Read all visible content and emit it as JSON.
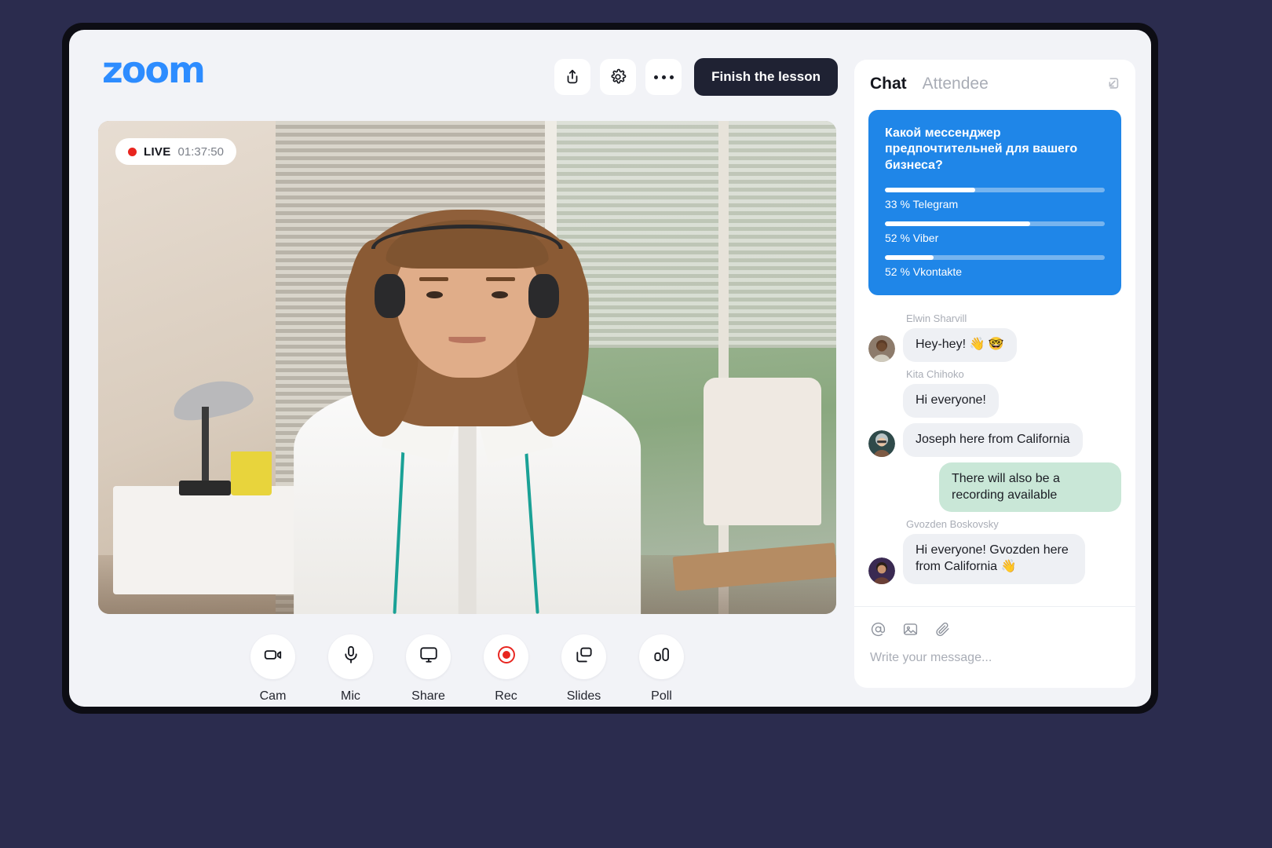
{
  "app": {
    "logo_text": "zoom",
    "finish_button": "Finish the lesson"
  },
  "header_icons": {
    "share": "share-icon",
    "settings": "gear-icon",
    "more": "more-dots-icon"
  },
  "video": {
    "live_label": "LIVE",
    "timer": "01:37:50",
    "live_dot_color": "#e8251f"
  },
  "toolbar": {
    "items": [
      {
        "label": "Cam",
        "icon": "camera-icon"
      },
      {
        "label": "Mic",
        "icon": "microphone-icon"
      },
      {
        "label": "Share",
        "icon": "screen-share-icon"
      },
      {
        "label": "Rec",
        "icon": "record-icon"
      },
      {
        "label": "Slides",
        "icon": "slides-icon"
      },
      {
        "label": "Poll",
        "icon": "poll-icon"
      }
    ]
  },
  "chat_panel": {
    "tabs": [
      {
        "label": "Chat",
        "active": true
      },
      {
        "label": "Attendee",
        "active": false
      }
    ],
    "expand_icon": "expand-panel-icon",
    "poll": {
      "question": "Какой мессенджер предпочтительней для вашего бизнеса?",
      "accent_color": "#1f86e8",
      "options": [
        {
          "label": "33 % Telegram",
          "percent": 41
        },
        {
          "label": "52 % Viber",
          "percent": 66
        },
        {
          "label": "52 % Vkontakte",
          "percent": 22
        }
      ]
    },
    "messages": [
      {
        "sender": "Elwin Sharvill",
        "text": "Hey-hey! 👋 🤓",
        "own": false,
        "show_name": true,
        "show_avatar": true
      },
      {
        "sender": "Kita Chihoko",
        "text": "Hi everyone!",
        "own": false,
        "show_name": true,
        "show_avatar": false
      },
      {
        "sender": "Kita Chihoko",
        "text": "Joseph here from California",
        "own": false,
        "show_name": false,
        "show_avatar": true
      },
      {
        "sender": "",
        "text": "There will also be a recording available",
        "own": true,
        "show_name": false,
        "show_avatar": false
      },
      {
        "sender": "Gvozden Boskovsky",
        "text": "Hi everyone! Gvozden here from California 👋",
        "own": false,
        "show_name": true,
        "show_avatar": true
      }
    ],
    "composer": {
      "icons": [
        "mention-icon",
        "image-icon",
        "attachment-icon"
      ],
      "placeholder": "Write your message..."
    }
  }
}
